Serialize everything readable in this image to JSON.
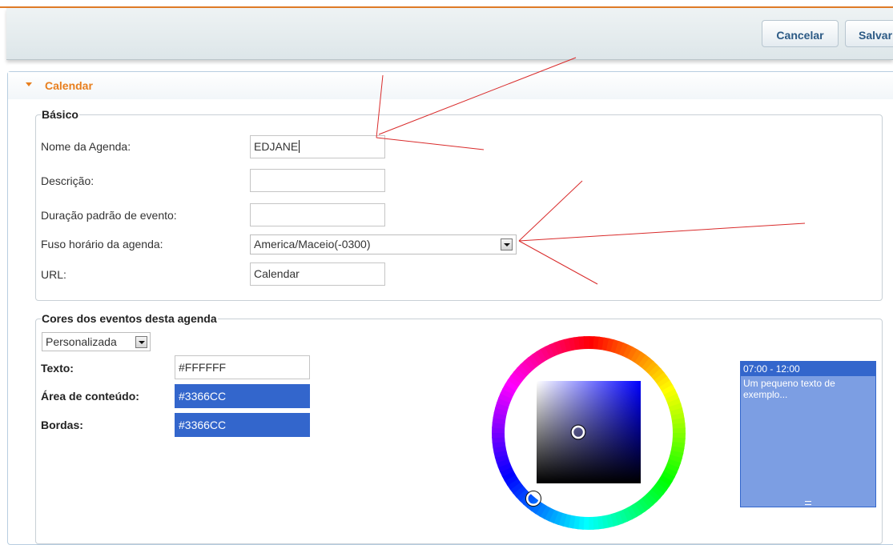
{
  "toolbar": {
    "cancel_label": "Cancelar",
    "save_label": "Salvar"
  },
  "panel": {
    "title": "Calendar"
  },
  "basic": {
    "legend": "Básico",
    "name_label": "Nome da Agenda:",
    "name_value": "EDJANE",
    "description_label": "Descrição:",
    "description_value": "",
    "duration_label": "Duração padrão de evento:",
    "duration_value": "",
    "timezone_label": "Fuso horário da agenda:",
    "timezone_value": "America/Maceio(-0300)",
    "url_label": "URL:",
    "url_value": "Calendar"
  },
  "colors": {
    "legend": "Cores dos eventos desta agenda",
    "scheme_value": "Personalizada",
    "text_label": "Texto:",
    "text_value": "#FFFFFF",
    "content_label": "Área de conteúdo:",
    "content_value": "#3366CC",
    "border_label": "Bordas:",
    "border_value": "#3366CC"
  },
  "preview": {
    "time": "07:00 - 12:00",
    "text": "Um pequeno texto de exemplo...",
    "grip": "="
  },
  "theme": {
    "accent": "#e87f1e",
    "event_color": "#3366CC",
    "annotation_color": "#d92b2b"
  }
}
